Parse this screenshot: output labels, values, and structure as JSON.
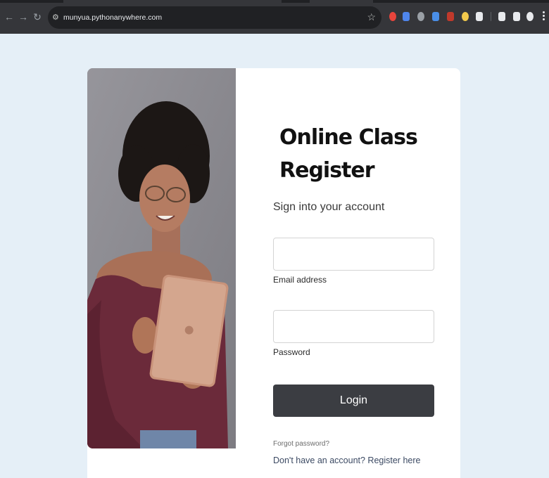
{
  "browser": {
    "url": "munyua.pythonanywhere.com",
    "back_icon": "←",
    "forward_icon": "→",
    "reload_icon": "↻",
    "site_info_icon": "⚙",
    "star_icon": "☆",
    "extension_colors": [
      "#e8453c",
      "#4f86ec",
      "#9aa0a6",
      "#4a8fe8",
      "#c0392b",
      "#f2c94c",
      "#e8eaed",
      "#e8eaed",
      "#e8eaed",
      "#e8eaed"
    ]
  },
  "login": {
    "title_line1": "Online Class",
    "title_line2": "Register",
    "subtitle": "Sign into your account",
    "email_label": "Email address",
    "password_label": "Password",
    "login_button": "Login",
    "forgot_password": "Forgot password?",
    "register_prompt": "Don't have an account? Register here"
  },
  "colors": {
    "page_background": "#e5eff7",
    "button": "#3b3d42"
  }
}
